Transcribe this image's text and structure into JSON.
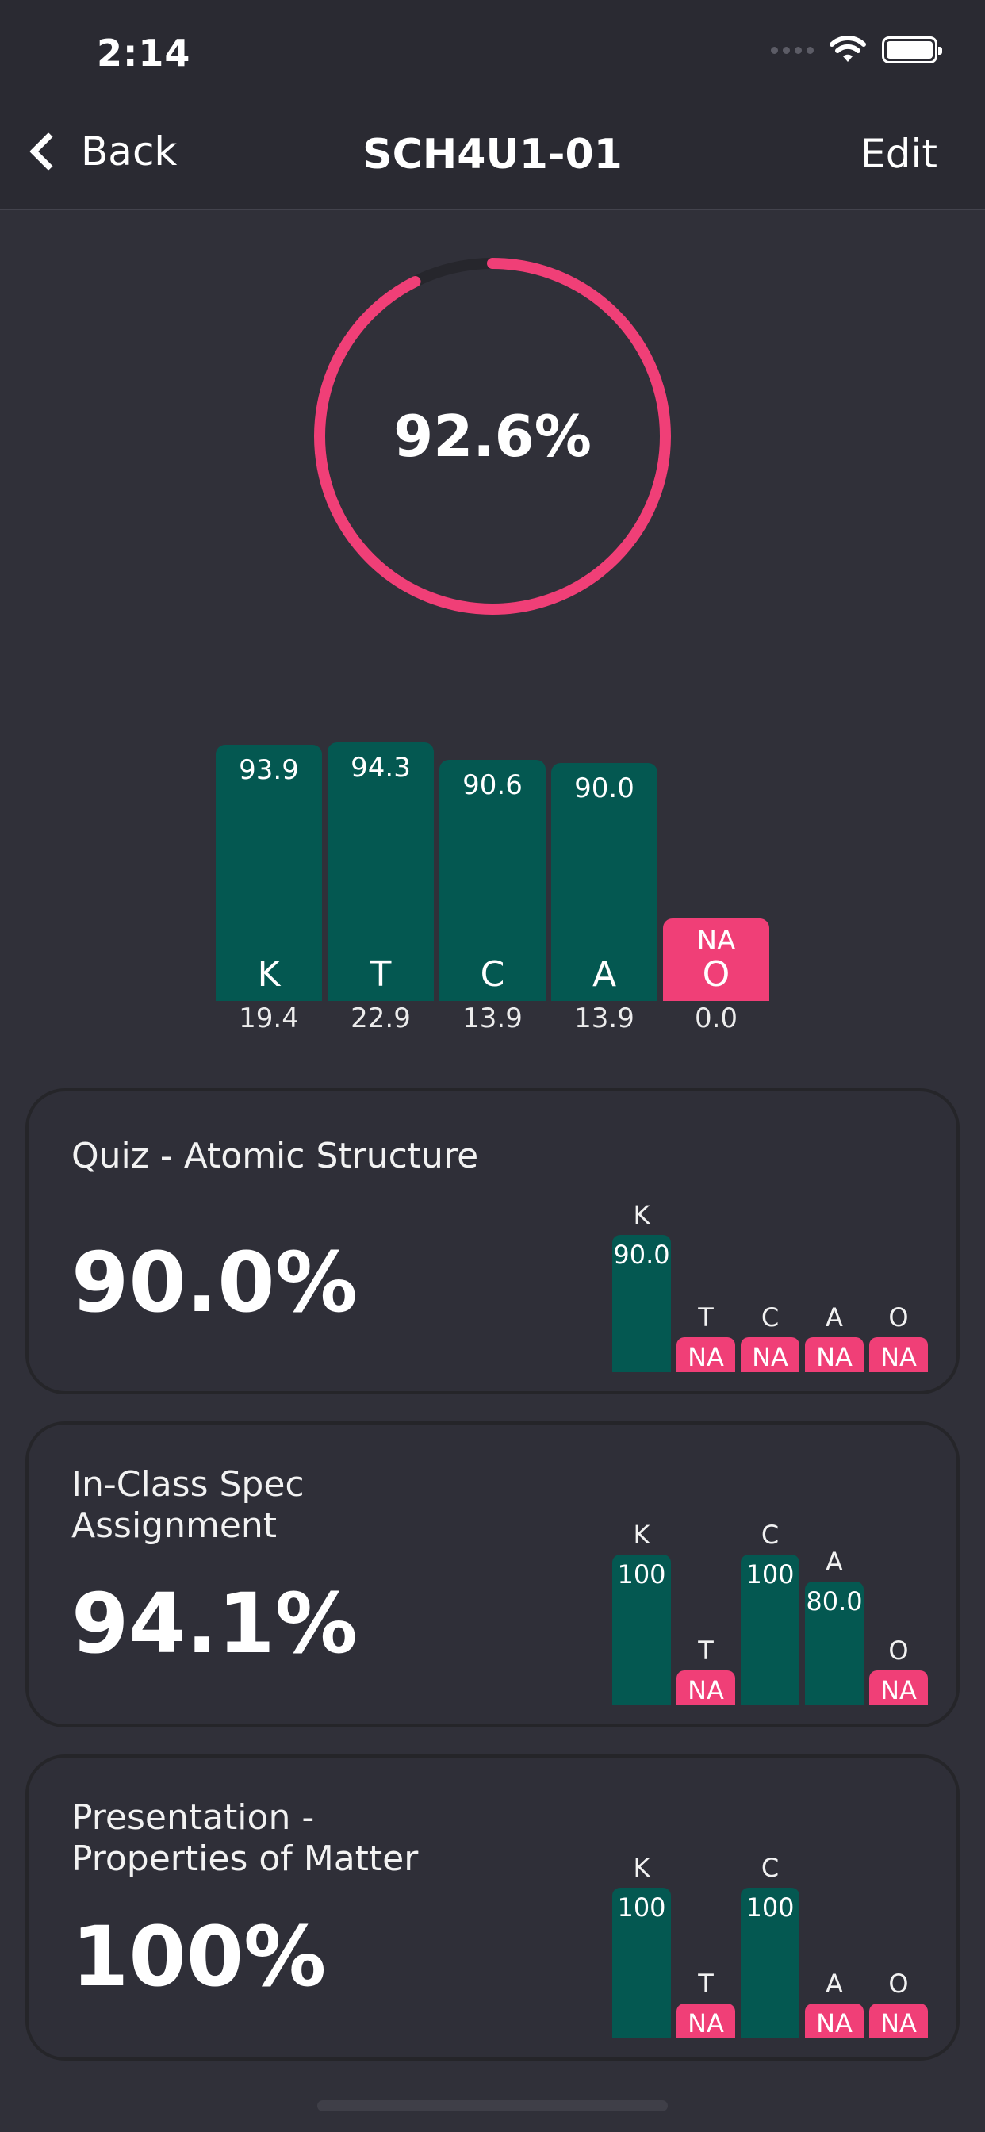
{
  "status_bar": {
    "time": "2:14"
  },
  "nav": {
    "back_label": "Back",
    "title": "SCH4U1-01",
    "edit_label": "Edit"
  },
  "overall": {
    "percent_label": "92.6%",
    "ring_fraction": 0.926,
    "ring_color": "#f03f77",
    "bars": [
      {
        "letter": "K",
        "mark": "93.9",
        "weight": "19.4",
        "status": "graded"
      },
      {
        "letter": "T",
        "mark": "94.3",
        "weight": "22.9",
        "status": "graded"
      },
      {
        "letter": "C",
        "mark": "90.6",
        "weight": "13.9",
        "status": "graded"
      },
      {
        "letter": "A",
        "mark": "90.0",
        "weight": "13.9",
        "status": "graded"
      },
      {
        "letter": "O",
        "mark": "NA",
        "weight": "0.0",
        "status": "na"
      }
    ]
  },
  "assessments": [
    {
      "title": "Quiz - Atomic Structure",
      "score": "90.0%",
      "categories": [
        {
          "letter": "K",
          "value": "90.0",
          "status": "graded"
        },
        {
          "letter": "T",
          "value": "NA",
          "status": "na"
        },
        {
          "letter": "C",
          "value": "NA",
          "status": "na"
        },
        {
          "letter": "A",
          "value": "NA",
          "status": "na"
        },
        {
          "letter": "O",
          "value": "NA",
          "status": "na"
        }
      ]
    },
    {
      "title": "In-Class Spec\nAssignment",
      "score": "94.1%",
      "categories": [
        {
          "letter": "K",
          "value": "100",
          "status": "graded"
        },
        {
          "letter": "T",
          "value": "NA",
          "status": "na"
        },
        {
          "letter": "C",
          "value": "100",
          "status": "graded"
        },
        {
          "letter": "A",
          "value": "80.0",
          "status": "graded"
        },
        {
          "letter": "O",
          "value": "NA",
          "status": "na"
        }
      ]
    },
    {
      "title": "Presentation -\nProperties of Matter",
      "score": "100%",
      "categories": [
        {
          "letter": "K",
          "value": "100",
          "status": "graded"
        },
        {
          "letter": "T",
          "value": "NA",
          "status": "na"
        },
        {
          "letter": "C",
          "value": "100",
          "status": "graded"
        },
        {
          "letter": "A",
          "value": "NA",
          "status": "na"
        },
        {
          "letter": "O",
          "value": "NA",
          "status": "na"
        }
      ]
    }
  ],
  "colors": {
    "graded": "#045851",
    "na": "#f03f77",
    "background": "#303039"
  }
}
